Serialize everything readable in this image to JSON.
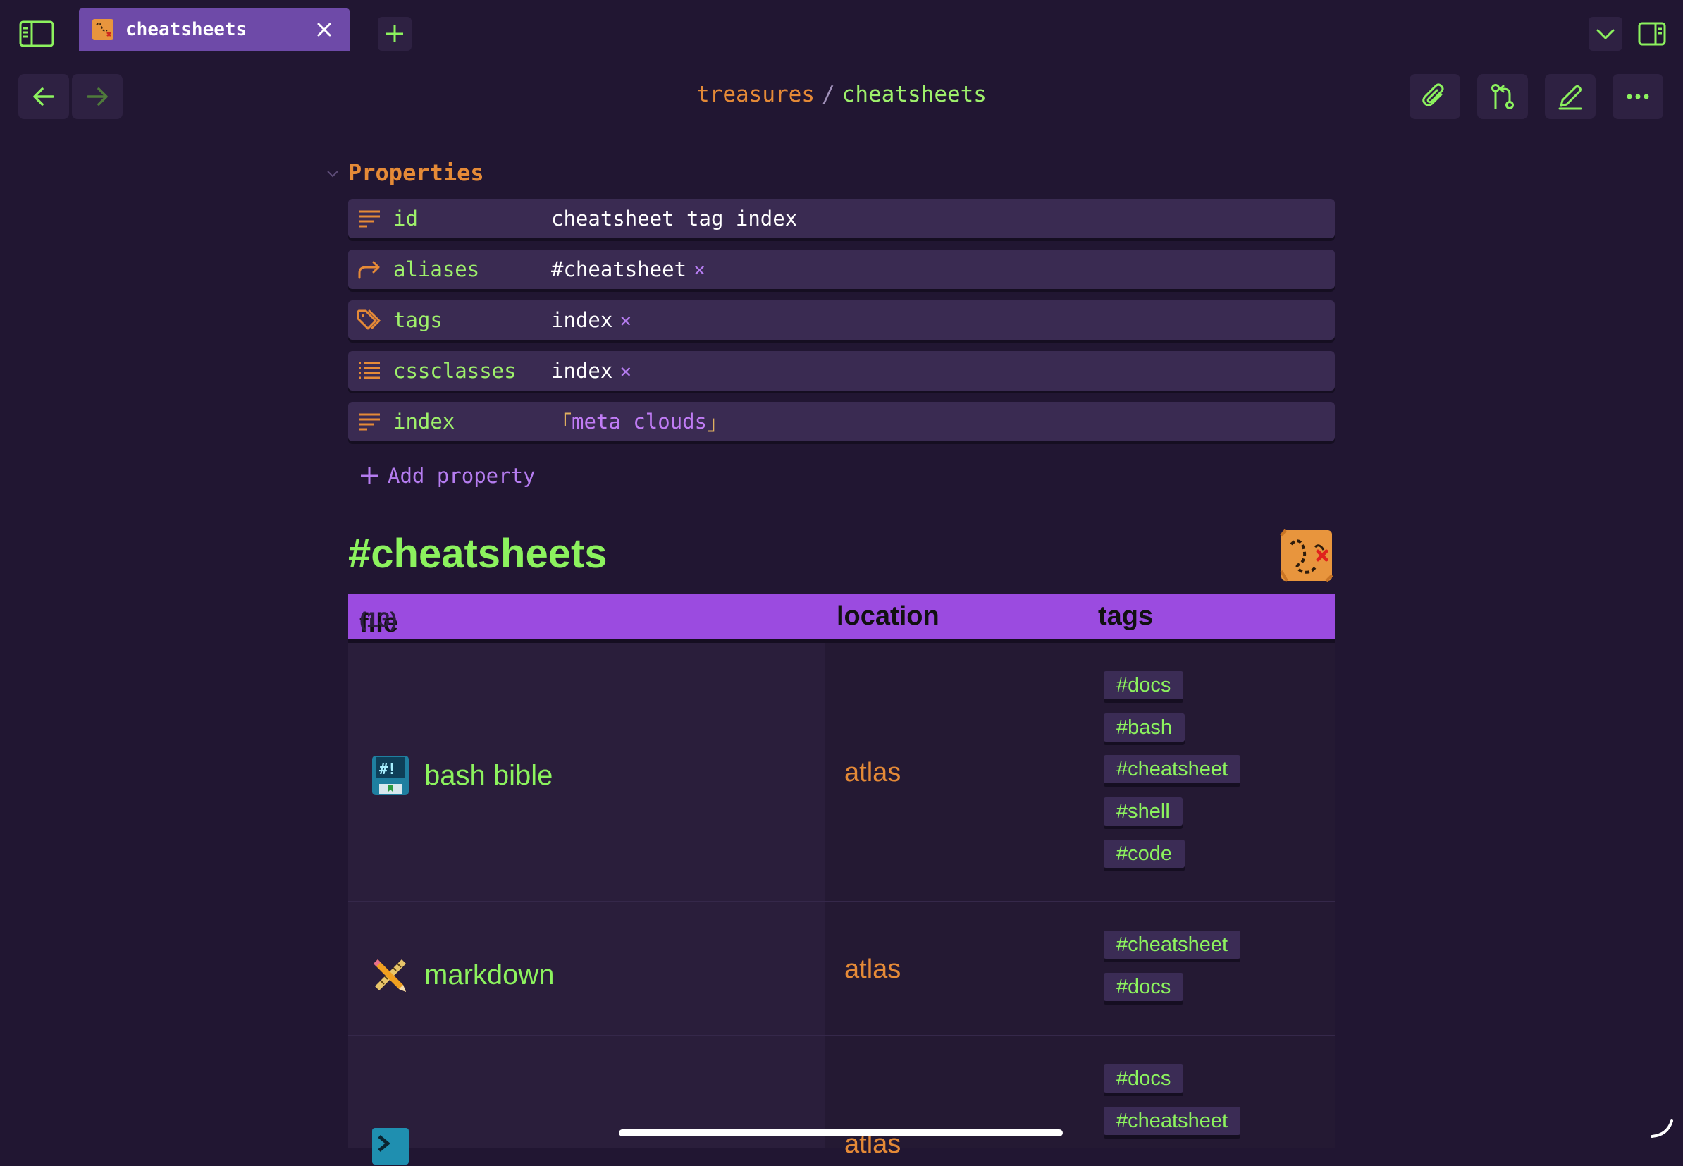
{
  "tab": {
    "title": "cheatsheets"
  },
  "breadcrumb": {
    "parent": "treasures",
    "separator": "/",
    "current": "cheatsheets"
  },
  "properties": {
    "title": "Properties",
    "items": [
      {
        "key": "id",
        "value": "cheatsheet tag index",
        "icon": "text-lines-icon"
      },
      {
        "key": "aliases",
        "value": "#cheatsheet",
        "icon": "forward-arrow-icon"
      },
      {
        "key": "tags",
        "value": "index",
        "icon": "tags-icon"
      },
      {
        "key": "cssclasses",
        "value": "index",
        "icon": "list-icon"
      },
      {
        "key": "index",
        "open_bracket": "「",
        "value": "meta clouds",
        "close_bracket": "」",
        "icon": "text-lines-icon"
      }
    ],
    "remove_glyph": "×",
    "add_label": "Add property"
  },
  "heading": "#cheatsheets",
  "table": {
    "headers": {
      "file": "file",
      "count": "(13)",
      "location": "location",
      "tags": "tags"
    },
    "rows": [
      {
        "file": "bash bible",
        "location": "atlas",
        "tags": [
          "#docs",
          "#bash",
          "#cheatsheet",
          "#shell",
          "#code"
        ]
      },
      {
        "file": "markdown",
        "location": "atlas",
        "tags": [
          "#cheatsheet",
          "#docs"
        ]
      },
      {
        "file": "",
        "location": "atlas",
        "tags": [
          "#docs",
          "#cheatsheet"
        ]
      }
    ]
  },
  "colors": {
    "background": "#211632",
    "accent_green": "#8cf25e",
    "accent_orange": "#e58a37",
    "accent_purple": "#9b4be0"
  }
}
